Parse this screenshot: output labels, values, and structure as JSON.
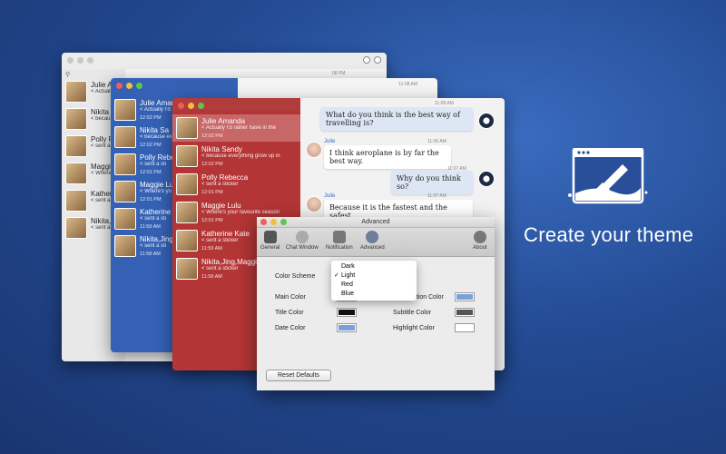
{
  "tagline": "Create your theme",
  "gray_window": {
    "search_icon": "search-icon",
    "timestamp": "08 PM",
    "contacts": [
      {
        "name": "Julie Am",
        "preview": "< Actually"
      },
      {
        "name": "Nikita S",
        "preview": "< because"
      },
      {
        "name": "Polly P",
        "preview": "< sent a"
      },
      {
        "name": "Maggie",
        "preview": "< Where"
      },
      {
        "name": "Katherin",
        "preview": "< sent a"
      },
      {
        "name": "Nikita,J",
        "preview": "< sent a"
      }
    ]
  },
  "blue_window": {
    "top_timestamp": "11:08 AM",
    "contacts": [
      {
        "name": "Julie Aman",
        "preview": "< Actually I'd",
        "time": "12:02 PM"
      },
      {
        "name": "Nikita Sa",
        "preview": "< because ev",
        "time": "12:02 PM"
      },
      {
        "name": "Polly Rebeca",
        "preview": "< sent a sti",
        "time": "12:01 PM"
      },
      {
        "name": "Maggie Lu",
        "preview": "< Where's yo",
        "time": "12:01 PM"
      },
      {
        "name": "Katherine",
        "preview": "< sent a sti",
        "time": "11:59 AM"
      },
      {
        "name": "Nikita,Jing,",
        "preview": "< sent a sti",
        "time": "11:58 AM"
      }
    ]
  },
  "red_window": {
    "contacts": [
      {
        "name": "Julie Amanda",
        "preview": "< Actually I'd rather have in the",
        "time": "12:02 PM"
      },
      {
        "name": "Nikita Sandy",
        "preview": "< because everything grow up in",
        "time": "12:02 PM"
      },
      {
        "name": "Polly  Rebecca",
        "preview": "< sent a sticker",
        "time": "12:01 PM"
      },
      {
        "name": "Maggie Lulu",
        "preview": "< Where's your favourite season",
        "time": "12:01 PM"
      },
      {
        "name": "Katherine Kate",
        "preview": "< sent a sticker",
        "time": "11:59 AM"
      },
      {
        "name": "Nikita,Jing,Maggie,Polly",
        "preview": "< sent a sticker",
        "time": "11:58 AM"
      }
    ],
    "messages": [
      {
        "sender": "",
        "time": "11:08 AM",
        "text": "What do you think is the best way of travelling is?",
        "mine": true
      },
      {
        "sender": "Julie",
        "time": "11:06 AM",
        "text": "I think aeroplane is by far the best way.",
        "mine": false
      },
      {
        "sender": "",
        "time": "11:07 AM",
        "text": "Why do you think so?",
        "mine": true
      },
      {
        "sender": "Julie",
        "time": "11:07 AM",
        "text": "Because it is the fastest and the safest. ...",
        "mine": false
      }
    ]
  },
  "advanced": {
    "title": "Advanced",
    "toolbar": [
      "General",
      "Chat Window",
      "Notification",
      "Advanced",
      "About"
    ],
    "color_scheme_label": "Color Scheme",
    "scheme_options": [
      "Dark",
      "Light",
      "Red",
      "Blue"
    ],
    "scheme_selected": "Light",
    "left_colors": [
      {
        "label": "Main Color",
        "color": "#7aa0d8"
      },
      {
        "label": "Title Color",
        "color": "#111111"
      },
      {
        "label": "Date Color",
        "color": "#7aa0d8"
      }
    ],
    "right_colors": [
      {
        "label": "ation Color",
        "color": "#7aa0d8"
      },
      {
        "label": "Subtitle Color",
        "color": "#555555"
      },
      {
        "label": "Highlight Color",
        "color": "#ffffff"
      }
    ],
    "reset_label": "Reset Defaults"
  }
}
